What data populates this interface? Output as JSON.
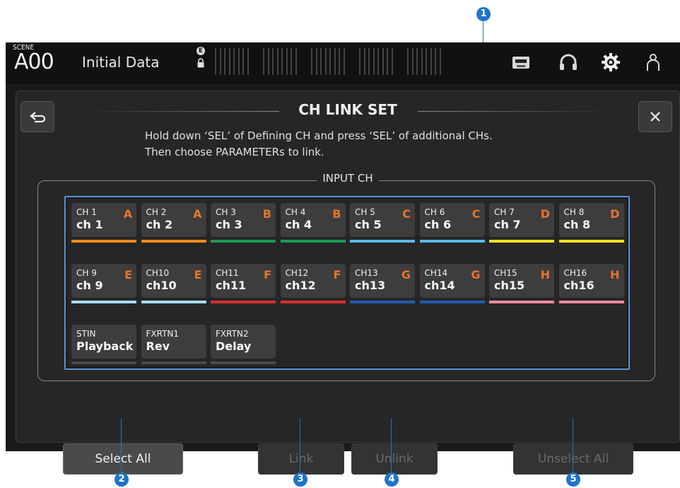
{
  "topbar": {
    "scene_label": "SCENE",
    "scene_number": "A00",
    "scene_title": "Initial Data",
    "e_badge": "E"
  },
  "dialog": {
    "title": "CH LINK SET",
    "instruction_line1": "Hold down ‘SEL’ of Defining CH and press ‘SEL’ of additional CHs.",
    "instruction_line2": "Then choose PARAMETERs to link.",
    "section_label": "INPUT CH",
    "close_glyph": "×"
  },
  "channels": [
    {
      "name": "CH 1",
      "label": "ch 1",
      "group": "A",
      "color": "#f08a1c"
    },
    {
      "name": "CH 2",
      "label": "ch 2",
      "group": "A",
      "color": "#f08a1c"
    },
    {
      "name": "CH 3",
      "label": "ch 3",
      "group": "B",
      "color": "#1a9a55"
    },
    {
      "name": "CH 4",
      "label": "ch 4",
      "group": "B",
      "color": "#1a9a55"
    },
    {
      "name": "CH 5",
      "label": "ch 5",
      "group": "C",
      "color": "#5ab8ea"
    },
    {
      "name": "CH 6",
      "label": "ch 6",
      "group": "C",
      "color": "#5ab8ea"
    },
    {
      "name": "CH 7",
      "label": "ch 7",
      "group": "D",
      "color": "#f2e21c"
    },
    {
      "name": "CH 8",
      "label": "ch 8",
      "group": "D",
      "color": "#f2e21c"
    },
    {
      "name": "CH 9",
      "label": "ch 9",
      "group": "E",
      "color": "#a8dcf2"
    },
    {
      "name": "CH10",
      "label": "ch10",
      "group": "E",
      "color": "#a8dcf2"
    },
    {
      "name": "CH11",
      "label": "ch11",
      "group": "F",
      "color": "#d93030"
    },
    {
      "name": "CH12",
      "label": "ch12",
      "group": "F",
      "color": "#d93030"
    },
    {
      "name": "CH13",
      "label": "ch13",
      "group": "G",
      "color": "#1f5cb0"
    },
    {
      "name": "CH14",
      "label": "ch14",
      "group": "G",
      "color": "#1f5cb0"
    },
    {
      "name": "CH15",
      "label": "ch15",
      "group": "H",
      "color": "#f08a9a"
    },
    {
      "name": "CH16",
      "label": "ch16",
      "group": "H",
      "color": "#f08a9a"
    },
    {
      "name": "STIN",
      "label": "Playback",
      "group": "",
      "color": "#4a4a4a"
    },
    {
      "name": "FXRTN1",
      "label": "Rev",
      "group": "",
      "color": "#4a4a4a"
    },
    {
      "name": "FXRTN2",
      "label": "Delay",
      "group": "",
      "color": "#4a4a4a"
    }
  ],
  "buttons": {
    "select_all": "Select All",
    "link": "Link",
    "unlink": "Unlink",
    "unselect_all": "Unselect All"
  },
  "callouts": [
    "1",
    "2",
    "3",
    "4",
    "5"
  ],
  "icons": [
    "back-arrow-icon",
    "close-icon",
    "tape-icon",
    "headphones-icon",
    "gear-icon",
    "user-icon",
    "lock-icon"
  ]
}
